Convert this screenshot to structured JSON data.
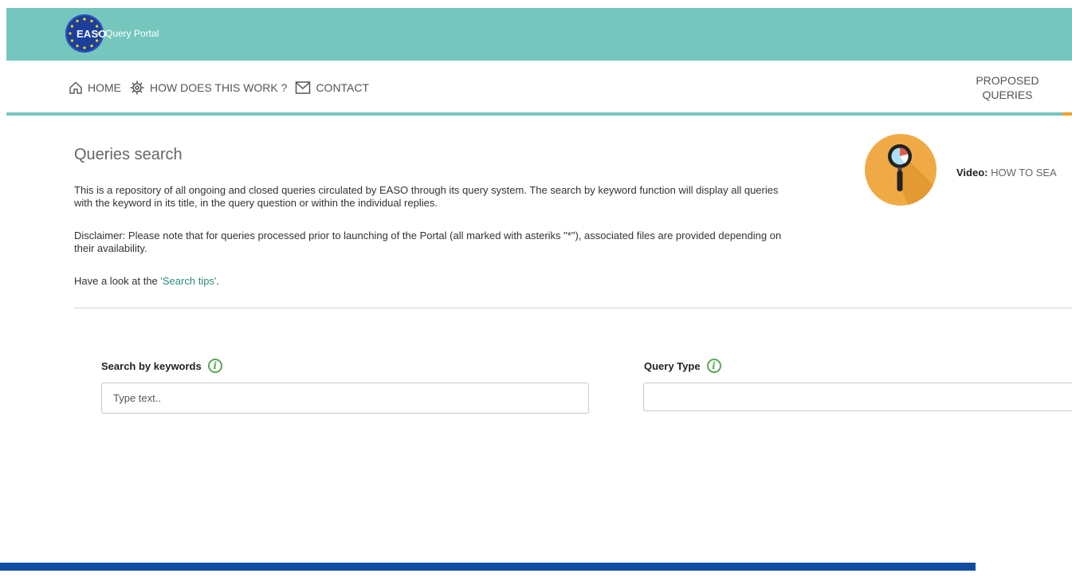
{
  "header": {
    "logo_text": "EASO",
    "portal_name": "Query Portal"
  },
  "nav": {
    "items": [
      {
        "label": "HOME",
        "icon": "home-icon"
      },
      {
        "label": "HOW DOES THIS WORK ?",
        "icon": "gear-icon"
      },
      {
        "label": "CONTACT",
        "icon": "mail-icon"
      }
    ],
    "proposed_line1": "PROPOSED",
    "proposed_line2": "QUERIES"
  },
  "main": {
    "title": "Queries search",
    "intro": "This is a repository of all ongoing and closed queries circulated by EASO through its query system. The search by keyword function will display all queries with the keyword in its title, in the query question or within the individual replies.",
    "disclaimer": "Disclaimer: Please note that for queries processed prior to launching of the Portal (all marked with asteriks \"*\"), associated files are provided depending on their availability.",
    "tips_prefix": "Have a look at the ",
    "tips_link": "'Search tips'",
    "tips_suffix": ".",
    "video_prefix": "Video:",
    "video_text": "HOW TO SEA"
  },
  "search": {
    "keywords_label": "Search by keywords",
    "keywords_placeholder": "Type text..",
    "keywords_value": "",
    "query_type_label": "Query Type",
    "query_type_value": ""
  },
  "colors": {
    "teal": "#75c6bd",
    "orange": "#f0aa45",
    "blue": "#0e4da2",
    "info_green": "#5aa65a"
  }
}
